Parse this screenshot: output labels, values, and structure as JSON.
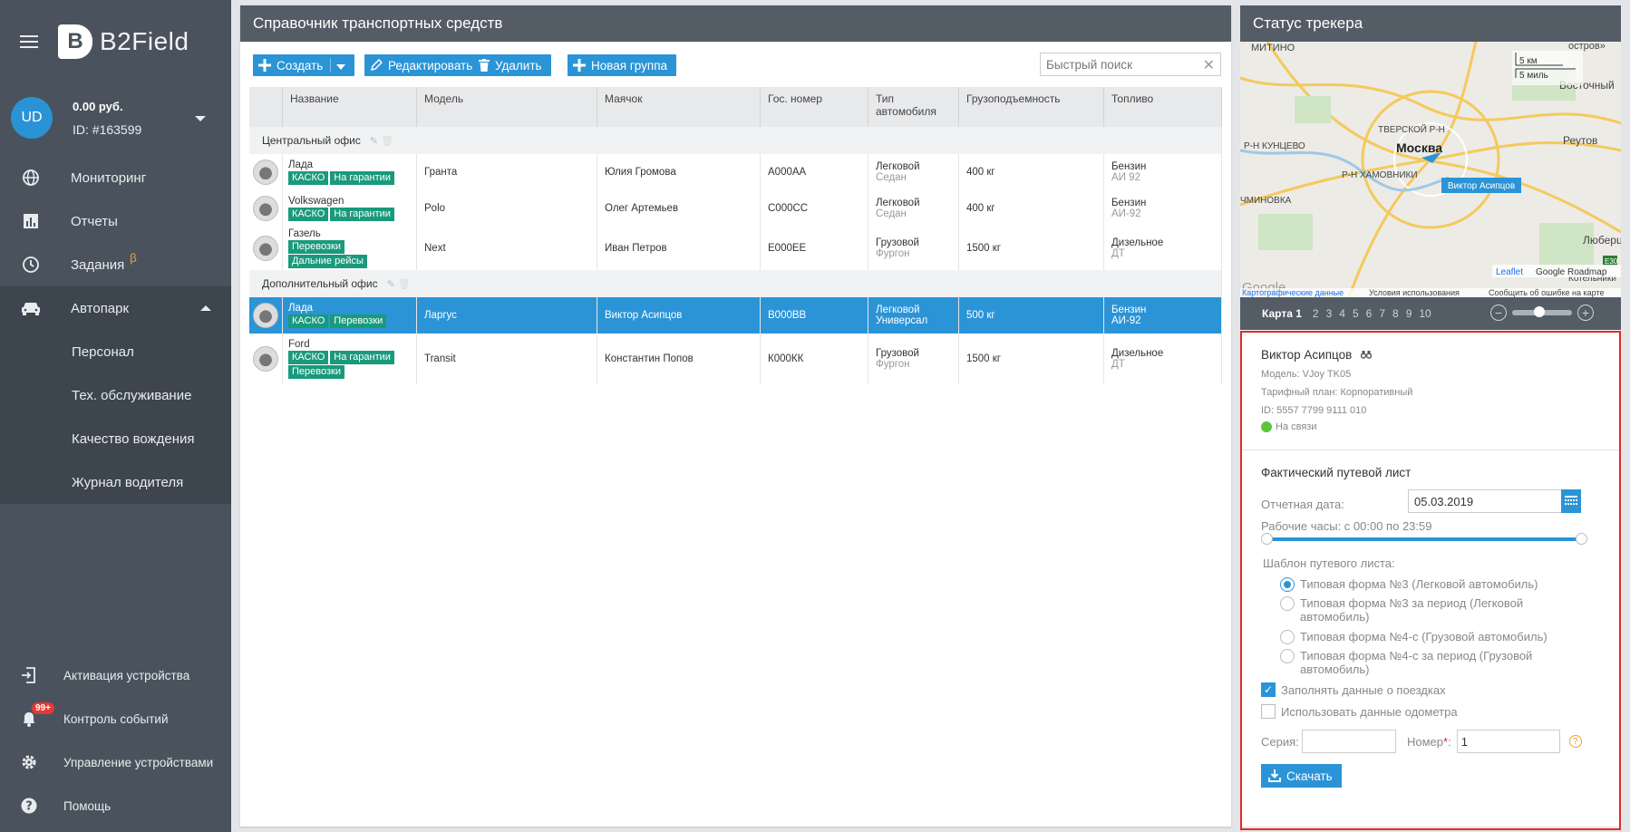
{
  "app": {
    "name": "B2Field",
    "logo_letter": "B"
  },
  "account": {
    "initials": "UD",
    "balance": "0.00 руб.",
    "id": "ID: #163599"
  },
  "nav": {
    "monitoring": "Мониторинг",
    "reports": "Отчеты",
    "tasks": "Задания",
    "tasks_beta": "β",
    "fleet": "Автопарк",
    "sub": [
      "Персонал",
      "Тех. обслуживание",
      "Качество вождения",
      "Журнал водителя"
    ],
    "bottom": {
      "activation": "Активация устройства",
      "events": "Контроль событий",
      "events_badge": "99+",
      "devices": "Управление устройствами",
      "help": "Помощь"
    }
  },
  "main": {
    "title": "Справочник транспортных средств",
    "toolbar": {
      "create": "Создать",
      "edit": "Редактировать",
      "delete": "Удалить",
      "new_group": "Новая группа"
    },
    "search_placeholder": "Быстрый поиск",
    "columns": [
      "Название",
      "Модель",
      "Маячок",
      "Гос. номер",
      "Тип автомобиля",
      "Грузоподъемность",
      "Топливо"
    ],
    "groups": [
      {
        "name": "Центральный офис",
        "rows": [
          {
            "brand": "Лада",
            "tags": [
              "КАСКО",
              "На гарантии"
            ],
            "model": "Гранта",
            "tracker": "Юлия Громова",
            "plate": "А000АА",
            "type": "Легковой",
            "body": "Седан",
            "capacity": "400 кг",
            "fuel": "Бензин",
            "fuel_sub": "АИ 92"
          },
          {
            "brand": "Volkswagen",
            "tags": [
              "КАСКО",
              "На гарантии"
            ],
            "model": "Polo",
            "tracker": "Олег Артемьев",
            "plate": "С000СС",
            "type": "Легковой",
            "body": "Седан",
            "capacity": "400 кг",
            "fuel": "Бензин",
            "fuel_sub": "АИ-92"
          },
          {
            "brand": "Газель",
            "tags": [
              "Перевозки",
              "Дальние рейсы"
            ],
            "model": "Next",
            "tracker": "Иван Петров",
            "plate": "Е000ЕЕ",
            "type": "Грузовой",
            "body": "Фургон",
            "capacity": "1500 кг",
            "fuel": "Дизельное",
            "fuel_sub": "ДТ"
          }
        ]
      },
      {
        "name": "Дополнительный офис",
        "rows": [
          {
            "brand": "Лада",
            "tags": [
              "КАСКО",
              "Перевозки"
            ],
            "model": "Ларгус",
            "tracker": "Виктор Асипцов",
            "plate": "В000ВВ",
            "type": "Легковой",
            "body": "Универсал",
            "capacity": "500 кг",
            "fuel": "Бензин",
            "fuel_sub": "АИ-92"
          },
          {
            "brand": "Ford",
            "tags": [
              "КАСКО",
              "На гарантии",
              "Перевозки"
            ],
            "model": "Transit",
            "tracker": "Константин Попов",
            "plate": "К000КК",
            "type": "Грузовой",
            "body": "Фургон",
            "capacity": "1500 кг",
            "fuel": "Дизельное",
            "fuel_sub": "ДТ"
          }
        ]
      }
    ]
  },
  "right": {
    "title": "Статус трекера",
    "map": {
      "labels": [
        "МИТИНО",
        "остров»",
        "Восточный",
        "ТВЕРСКОЙ Р-Н",
        "Москва",
        "Р-Н КУНЦЕВО",
        "Реутов",
        "Р-Н ХАМОВНИКИ",
        "ЧМИНОВКА",
        "Люберцы",
        "Котельники",
        "E30"
      ],
      "marker_label": "Виктор Асипцов",
      "scale_km": "5 км",
      "scale_mi": "5 миль",
      "attribution_left": "Картографические данные",
      "attribution_terms": "Условия использования",
      "attribution_report": "Сообщить об ошибке на карте",
      "leaflet": "Leaflet",
      "roadmap": "Google Roadmap",
      "google": "Google"
    },
    "map_tabs": {
      "label": "Карта 1",
      "nums": [
        "2",
        "3",
        "4",
        "5",
        "6",
        "7",
        "8",
        "9",
        "10"
      ]
    },
    "tracker": {
      "name": "Виктор Асипцов",
      "model": "Модель: VJoy TK05",
      "plan": "Тарифный план: Корпоративный",
      "id": "ID: 5557 7799 9111 010",
      "status": "На связи"
    },
    "waybill": {
      "title": "Фактический путевой лист",
      "date_label": "Отчетная дата:",
      "date_value": "05.03.2019",
      "hours_label": "Рабочие часы: с 00:00 по 23:59",
      "template_label": "Шаблон путевого листа:",
      "templates": [
        "Типовая форма №3 (Легковой автомобиль)",
        "Типовая форма №3 за период (Легковой автомобиль)",
        "Типовая форма №4-с (Грузовой автомобиль)",
        "Типовая форма №4-с за период (Грузовой автомобиль)"
      ],
      "fill_trips": "Заполнять данные о поездках",
      "use_odometer": "Использовать данные одометра",
      "series_label": "Серия:",
      "series_value": "",
      "number_label": "Номер",
      "number_required": "*",
      "number_colon": ":",
      "number_value": "1",
      "help": "?",
      "download": "Скачать"
    }
  },
  "colors": {
    "accent": "#2b94d6",
    "sidebar": "#4a535d",
    "tag": "#1a9a7c",
    "highlight_border": "#e02b2b"
  }
}
